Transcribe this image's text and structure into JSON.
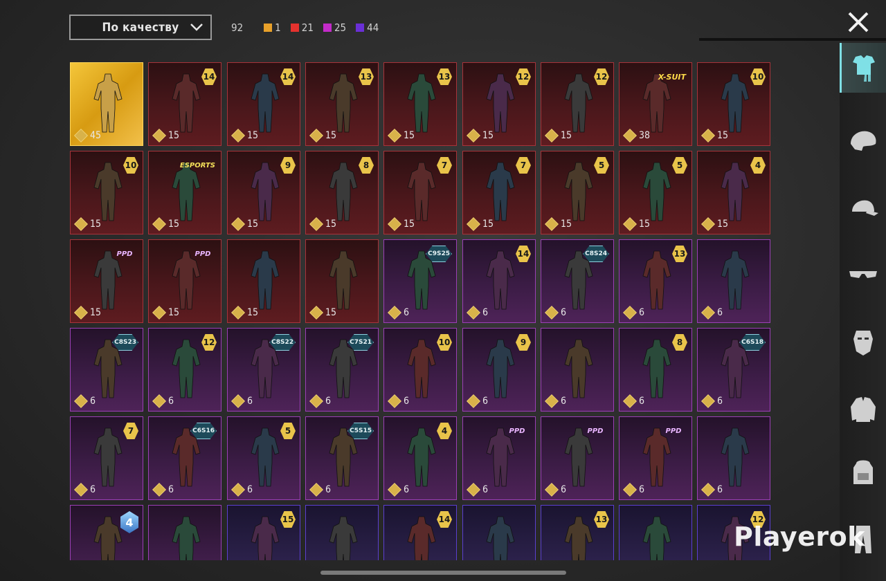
{
  "sort": {
    "label": "По качеству"
  },
  "counts": {
    "total": "92",
    "items": [
      {
        "color": "#e8a12a",
        "value": "1"
      },
      {
        "color": "#e5322e",
        "value": "21"
      },
      {
        "color": "#c32bc9",
        "value": "25"
      },
      {
        "color": "#6a2fd6",
        "value": "44"
      }
    ]
  },
  "rail": {
    "categories": [
      "outfit-icon",
      "headgear-icon",
      "cap-icon",
      "glasses-icon",
      "mask-icon",
      "jacket-icon",
      "backpack-icon",
      "pants-icon"
    ]
  },
  "watermark": "Playerok",
  "cards": [
    {
      "rarity": "gold",
      "badge": "",
      "badge_type": "",
      "points": "45"
    },
    {
      "rarity": "red",
      "badge": "14",
      "badge_type": "level",
      "points": "15"
    },
    {
      "rarity": "red",
      "badge": "14",
      "badge_type": "level",
      "points": "15"
    },
    {
      "rarity": "red",
      "badge": "13",
      "badge_type": "level",
      "points": "15"
    },
    {
      "rarity": "red",
      "badge": "13",
      "badge_type": "level",
      "points": "15"
    },
    {
      "rarity": "red",
      "badge": "12",
      "badge_type": "level",
      "points": "15"
    },
    {
      "rarity": "red",
      "badge": "12",
      "badge_type": "level",
      "points": "15"
    },
    {
      "rarity": "red",
      "badge": "X-SUIT",
      "badge_type": "xsuit",
      "points": "38"
    },
    {
      "rarity": "red",
      "badge": "10",
      "badge_type": "level",
      "points": "15"
    },
    {
      "rarity": "red",
      "badge": "10",
      "badge_type": "level",
      "points": "15"
    },
    {
      "rarity": "red",
      "badge": "ESPORTS",
      "badge_type": "tag",
      "points": "15"
    },
    {
      "rarity": "red",
      "badge": "9",
      "badge_type": "level",
      "points": "15"
    },
    {
      "rarity": "red",
      "badge": "8",
      "badge_type": "level",
      "points": "15"
    },
    {
      "rarity": "red",
      "badge": "7",
      "badge_type": "level",
      "points": "15"
    },
    {
      "rarity": "red",
      "badge": "7",
      "badge_type": "level",
      "points": "15"
    },
    {
      "rarity": "red",
      "badge": "5",
      "badge_type": "level",
      "points": "15"
    },
    {
      "rarity": "red",
      "badge": "5",
      "badge_type": "level",
      "points": "15"
    },
    {
      "rarity": "red",
      "badge": "4",
      "badge_type": "level",
      "points": "15"
    },
    {
      "rarity": "red",
      "badge": "PPD",
      "badge_type": "tag-purple",
      "points": "15"
    },
    {
      "rarity": "red",
      "badge": "PPD",
      "badge_type": "tag-purple",
      "points": "15"
    },
    {
      "rarity": "red",
      "badge": "",
      "badge_type": "",
      "points": "15"
    },
    {
      "rarity": "red",
      "badge": "",
      "badge_type": "",
      "points": "15"
    },
    {
      "rarity": "purple",
      "badge": "C9S25",
      "badge_type": "season",
      "points": "6"
    },
    {
      "rarity": "purple",
      "badge": "14",
      "badge_type": "level",
      "points": "6"
    },
    {
      "rarity": "purple",
      "badge": "C8S24",
      "badge_type": "season",
      "points": "6"
    },
    {
      "rarity": "purple",
      "badge": "13",
      "badge_type": "level",
      "points": "6"
    },
    {
      "rarity": "purple",
      "badge": "",
      "badge_type": "",
      "points": "6"
    },
    {
      "rarity": "purple",
      "badge": "C8S23",
      "badge_type": "season",
      "points": "6"
    },
    {
      "rarity": "purple",
      "badge": "12",
      "badge_type": "level",
      "points": "6"
    },
    {
      "rarity": "purple",
      "badge": "C8S22",
      "badge_type": "season",
      "points": "6"
    },
    {
      "rarity": "purple",
      "badge": "C7S21",
      "badge_type": "season",
      "points": "6"
    },
    {
      "rarity": "purple",
      "badge": "10",
      "badge_type": "level",
      "points": "6"
    },
    {
      "rarity": "purple",
      "badge": "9",
      "badge_type": "level",
      "points": "6"
    },
    {
      "rarity": "purple",
      "badge": "",
      "badge_type": "",
      "points": "6"
    },
    {
      "rarity": "purple",
      "badge": "8",
      "badge_type": "level",
      "points": "6"
    },
    {
      "rarity": "purple",
      "badge": "C6S18",
      "badge_type": "season",
      "points": "6"
    },
    {
      "rarity": "purple",
      "badge": "7",
      "badge_type": "level",
      "points": "6"
    },
    {
      "rarity": "purple",
      "badge": "C6S16",
      "badge_type": "season",
      "points": "6"
    },
    {
      "rarity": "purple",
      "badge": "5",
      "badge_type": "level",
      "points": "6"
    },
    {
      "rarity": "purple",
      "badge": "C5S15",
      "badge_type": "season",
      "points": "6"
    },
    {
      "rarity": "purple",
      "badge": "4",
      "badge_type": "level",
      "points": "6"
    },
    {
      "rarity": "purple",
      "badge": "PPD",
      "badge_type": "tag-purple",
      "points": "6"
    },
    {
      "rarity": "purple",
      "badge": "PPD",
      "badge_type": "tag-purple",
      "points": "6"
    },
    {
      "rarity": "purple",
      "badge": "PPD",
      "badge_type": "tag-purple",
      "points": "6"
    },
    {
      "rarity": "purple",
      "badge": "",
      "badge_type": "",
      "points": "6"
    },
    {
      "rarity": "purple",
      "badge": "4",
      "badge_type": "tier",
      "points": ""
    },
    {
      "rarity": "purple",
      "badge": "",
      "badge_type": "",
      "points": ""
    },
    {
      "rarity": "violet",
      "badge": "15",
      "badge_type": "level",
      "points": ""
    },
    {
      "rarity": "violet",
      "badge": "",
      "badge_type": "",
      "points": ""
    },
    {
      "rarity": "violet",
      "badge": "14",
      "badge_type": "level",
      "points": ""
    },
    {
      "rarity": "violet",
      "badge": "",
      "badge_type": "",
      "points": ""
    },
    {
      "rarity": "violet",
      "badge": "13",
      "badge_type": "level",
      "points": ""
    },
    {
      "rarity": "violet",
      "badge": "",
      "badge_type": "",
      "points": ""
    },
    {
      "rarity": "violet",
      "badge": "12",
      "badge_type": "level",
      "points": ""
    }
  ]
}
